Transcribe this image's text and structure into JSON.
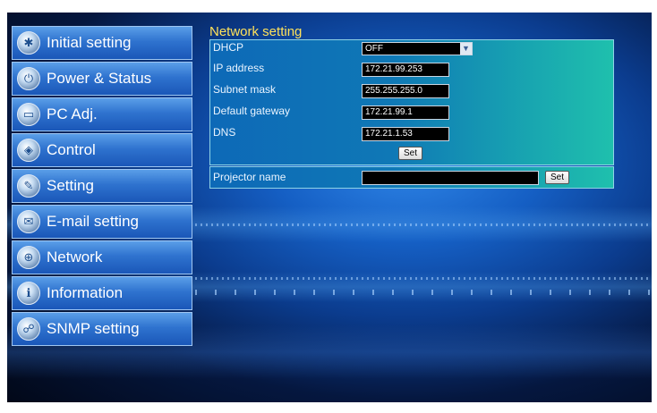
{
  "nav": {
    "items": [
      {
        "label": "Initial setting",
        "icon": "tools-icon"
      },
      {
        "label": "Power & Status",
        "icon": "power-icon"
      },
      {
        "label": "PC Adj.",
        "icon": "monitor-icon"
      },
      {
        "label": "Control",
        "icon": "control-icon"
      },
      {
        "label": "Setting",
        "icon": "wrench-icon"
      },
      {
        "label": "E-mail setting",
        "icon": "mail-icon"
      },
      {
        "label": "Network",
        "icon": "network-icon"
      },
      {
        "label": "Information",
        "icon": "info-icon"
      },
      {
        "label": "SNMP setting",
        "icon": "snmp-icon"
      }
    ]
  },
  "network": {
    "title": "Network setting",
    "dhcp": {
      "label": "DHCP",
      "value": "OFF"
    },
    "ip": {
      "label": "IP address",
      "value": "172.21.99.253"
    },
    "subnet": {
      "label": "Subnet mask",
      "value": "255.255.255.0"
    },
    "gateway": {
      "label": "Default gateway",
      "value": "172.21.99.1"
    },
    "dns": {
      "label": "DNS",
      "value": "172.21.1.53"
    },
    "set_label": "Set"
  },
  "projector": {
    "label": "Projector name",
    "value": "",
    "set_label": "Set"
  },
  "colors": {
    "title": "#ffe25a",
    "nav_bg": "#2f73cf",
    "panel_bg": "#0f78b6"
  }
}
